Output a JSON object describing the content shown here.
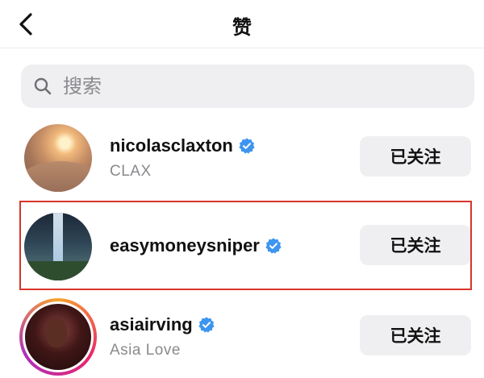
{
  "header": {
    "title": "赞"
  },
  "search": {
    "placeholder": "搜索"
  },
  "users": [
    {
      "username": "nicolasclaxton",
      "full_name": "CLAX",
      "verified": true,
      "follow_label": "已关注"
    },
    {
      "username": "easymoneysniper",
      "full_name": "",
      "verified": true,
      "follow_label": "已关注"
    },
    {
      "username": "asiairving",
      "full_name": "Asia Love",
      "verified": true,
      "follow_label": "已关注"
    }
  ],
  "colors": {
    "verified": "#3d95f0",
    "highlight": "#d8352a",
    "button_bg": "#efeff1"
  }
}
